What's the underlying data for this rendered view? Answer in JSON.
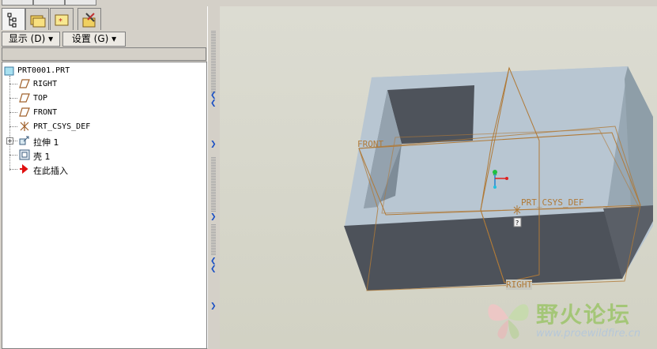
{
  "menu": {
    "display": "显示 (D) ▾",
    "settings": "设置 (G) ▾"
  },
  "tree": {
    "root": "PRT0001.PRT",
    "items": [
      {
        "label": "RIGHT",
        "icon": "datum-plane-icon"
      },
      {
        "label": "TOP",
        "icon": "datum-plane-icon"
      },
      {
        "label": "FRONT",
        "icon": "datum-plane-icon"
      },
      {
        "label": "PRT_CSYS_DEF",
        "icon": "coordinate-system-icon"
      },
      {
        "label": "拉伸 1",
        "icon": "extrude-icon"
      },
      {
        "label": "壳 1",
        "icon": "shell-icon"
      },
      {
        "label": "在此插入",
        "icon": "insert-here-arrow-icon"
      }
    ]
  },
  "viewport": {
    "labels": {
      "front": "FRONT",
      "csys": "PRT_CSYS_DEF",
      "right": "RIGHT"
    }
  },
  "watermark": {
    "name": "野火论坛",
    "url": "www.proewildfire.cn"
  },
  "colors": {
    "datum": "#b07a38",
    "model_light": "#b4c4d0",
    "model_dark": "#50545c"
  }
}
